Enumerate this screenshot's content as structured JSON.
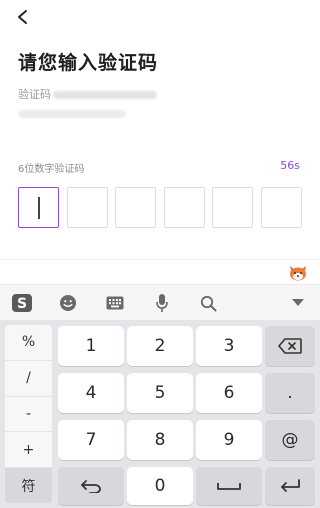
{
  "header": {
    "title": "请您输入验证码",
    "sent_prefix": "验证码"
  },
  "code": {
    "label": "6位数字验证码",
    "countdown": "56s",
    "digits": [
      "",
      "",
      "",
      "",
      "",
      ""
    ],
    "accent_color": "#8a4cd6"
  },
  "ime_toolbar": {
    "icons": [
      "sogou-logo-icon",
      "emoji-icon",
      "keyboard-icon",
      "microphone-icon",
      "search-icon",
      "collapse-keyboard-icon"
    ]
  },
  "keyboard": {
    "side_keys": [
      "%",
      "/",
      "-",
      "+",
      "符"
    ],
    "digit_rows": [
      [
        "1",
        "2",
        "3"
      ],
      [
        "4",
        "5",
        "6"
      ],
      [
        "7",
        "8",
        "9"
      ]
    ],
    "zero": "0",
    "dot": ".",
    "at": "@"
  }
}
